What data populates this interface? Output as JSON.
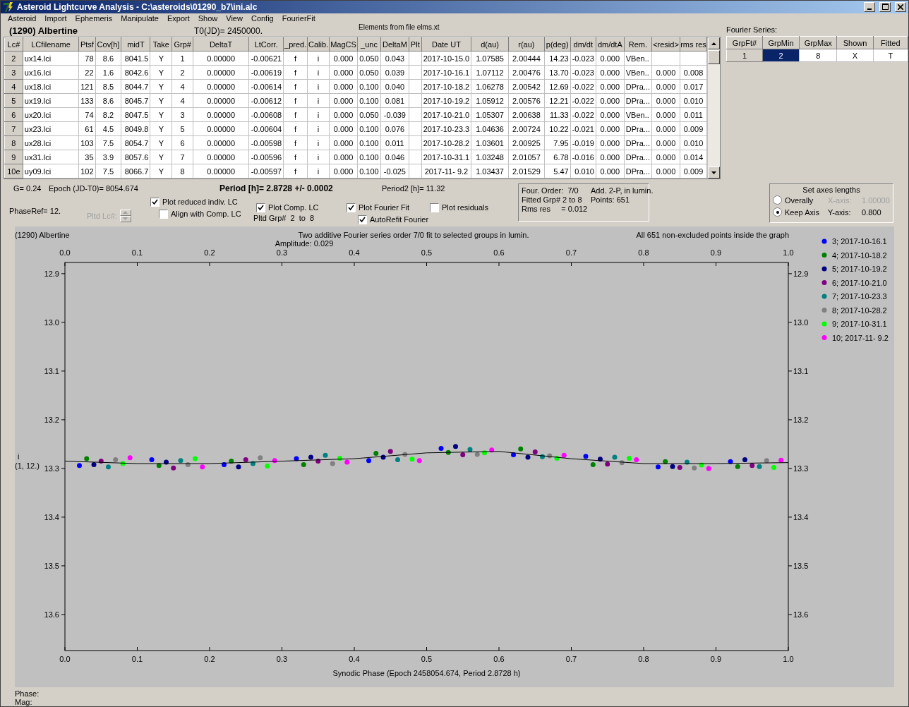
{
  "window": {
    "title": "Asteroid Lightcurve Analysis - C:\\asteroids\\01290_b7\\ini.alc"
  },
  "menu": [
    "Asteroid",
    "Import",
    "Ephemeris",
    "Manipulate",
    "Export",
    "Show",
    "View",
    "Config",
    "FourierFit"
  ],
  "header": {
    "asteroid": "(1290) Albertine",
    "t0": "T0(JD)= 2450000.",
    "elements": "Elements from file elms.xt"
  },
  "lc_table": {
    "columns": [
      "Lc#",
      "LCfilename",
      "Ptsf",
      "Cov[h]",
      "midT",
      "Take",
      "Grp#",
      "DeltaT",
      "LtCorr.",
      "_pred.",
      "Calib.",
      "MagCS",
      "_unc",
      "DeltaM",
      "Plt",
      "Date UT",
      "d(au)",
      "r(au)",
      "p(deg)",
      "dm/dt",
      "dm/dtA",
      "Rem.",
      "<resid>",
      "rms res"
    ],
    "rows": [
      [
        "2",
        "ux14.lci",
        "78",
        "8.6",
        "8041.5",
        "Y",
        "1",
        "0.00000",
        "-0.00621",
        "f",
        "i",
        "0.000",
        "0.050",
        "0.043",
        "",
        "2017-10-15.0",
        "1.07585",
        "2.00444",
        "14.23",
        "-0.023",
        "0.000",
        "VBen..",
        "",
        ""
      ],
      [
        "3",
        "ux16.lci",
        "22",
        "1.6",
        "8042.6",
        "Y",
        "2",
        "0.00000",
        "-0.00619",
        "f",
        "i",
        "0.000",
        "0.050",
        "0.039",
        "",
        "2017-10-16.1",
        "1.07112",
        "2.00476",
        "13.70",
        "-0.023",
        "0.000",
        "VBen..",
        "0.000",
        "0.008"
      ],
      [
        "4",
        "ux18.lci",
        "121",
        "8.5",
        "8044.7",
        "Y",
        "4",
        "0.00000",
        "-0.00614",
        "f",
        "i",
        "0.000",
        "0.100",
        "0.040",
        "",
        "2017-10-18.2",
        "1.06278",
        "2.00542",
        "12.69",
        "-0.022",
        "0.000",
        "DPra...",
        "0.000",
        "0.017"
      ],
      [
        "5",
        "ux19.lci",
        "133",
        "8.6",
        "8045.7",
        "Y",
        "4",
        "0.00000",
        "-0.00612",
        "f",
        "i",
        "0.000",
        "0.100",
        "0.081",
        "",
        "2017-10-19.2",
        "1.05912",
        "2.00576",
        "12.21",
        "-0.022",
        "0.000",
        "DPra...",
        "0.000",
        "0.010"
      ],
      [
        "6",
        "ux20.lci",
        "74",
        "8.2",
        "8047.5",
        "Y",
        "3",
        "0.00000",
        "-0.00608",
        "f",
        "i",
        "0.000",
        "0.050",
        "-0.039",
        "",
        "2017-10-21.0",
        "1.05307",
        "2.00638",
        "11.33",
        "-0.022",
        "0.000",
        "VBen..",
        "0.000",
        "0.011"
      ],
      [
        "7",
        "ux23.lci",
        "61",
        "4.5",
        "8049.8",
        "Y",
        "5",
        "0.00000",
        "-0.00604",
        "f",
        "i",
        "0.000",
        "0.100",
        "0.076",
        "",
        "2017-10-23.3",
        "1.04636",
        "2.00724",
        "10.22",
        "-0.021",
        "0.000",
        "DPra...",
        "0.000",
        "0.009"
      ],
      [
        "8",
        "ux28.lci",
        "103",
        "7.5",
        "8054.7",
        "Y",
        "6",
        "0.00000",
        "-0.00598",
        "f",
        "i",
        "0.000",
        "0.100",
        "0.011",
        "",
        "2017-10-28.2",
        "1.03601",
        "2.00925",
        "7.95",
        "-0.019",
        "0.000",
        "DPra...",
        "0.000",
        "0.010"
      ],
      [
        "9",
        "ux31.lci",
        "35",
        "3.9",
        "8057.6",
        "Y",
        "7",
        "0.00000",
        "-0.00596",
        "f",
        "i",
        "0.000",
        "0.100",
        "0.046",
        "",
        "2017-10-31.1",
        "1.03248",
        "2.01057",
        "6.78",
        "-0.016",
        "0.000",
        "DPra...",
        "0.000",
        "0.014"
      ],
      [
        "10e",
        "uy09.lci",
        "102",
        "7.5",
        "8066.7",
        "Y",
        "8",
        "0.00000",
        "-0.00597",
        "f",
        "i",
        "0.000",
        "0.100",
        "-0.025",
        "",
        "2017-11- 9.2",
        "1.03437",
        "2.01529",
        "5.47",
        "0.010",
        "0.000",
        "DPra...",
        "0.000",
        "0.009"
      ]
    ]
  },
  "fourier": {
    "label": "Fourier Series:",
    "columns": [
      "GrpFt#",
      "GrpMin",
      "GrpMax",
      "Shown",
      "Fitted"
    ],
    "row": [
      {
        "text": "1",
        "selected": false
      },
      {
        "text": "2",
        "selected": true
      },
      {
        "text": "8",
        "selected": false
      },
      {
        "text": "X",
        "selected": false
      },
      {
        "text": "T",
        "selected": false
      }
    ]
  },
  "params": {
    "g": "G= 0.24",
    "epoch": "Epoch (JD-T0)= 8054.674",
    "period": "Period [h]= 2.8728 +/- 0.0002",
    "period2": "Period2 [h]= 11.32",
    "phaseref": "PhaseRef= 12.",
    "pltd_lc": {
      "label": "Pltd Lc#:",
      "disabled": true
    },
    "pltd_grp": "Pltd Grp#  2  to  8"
  },
  "checkboxes": [
    {
      "label": "Plot reduced indiv. LC",
      "checked": true
    },
    {
      "label": "Align with Comp. LC",
      "checked": false
    },
    {
      "label": "Plot Comp. LC",
      "checked": true
    },
    {
      "label": "Plot Fourier Fit",
      "checked": true
    },
    {
      "label": "Plot residuals",
      "checked": false
    },
    {
      "label": "AutoRefit Fourier",
      "checked": true
    }
  ],
  "fit_info": [
    "Four. Order:  7/0",
    "Add. 2-P, in lumin.",
    "Fitted Grp# 2 to 8",
    "Points: 651",
    "Rms res     = 0.012"
  ],
  "axes": {
    "title": "Set axes lengths",
    "options": [
      {
        "label": "Overally",
        "selected": false
      },
      {
        "label": "Keep Axis",
        "selected": true
      }
    ],
    "x_label": "X-axis:",
    "x_value": "1.00000",
    "x_disabled": true,
    "y_label": "Y-axis:",
    "y_value": "0.800"
  },
  "plot": {
    "header_left": "(1290) Albertine",
    "header_right": "All 651 non-excluded points inside the graph",
    "chart_data": {
      "type": "scatter",
      "title": "Two additive Fourier series order 7/0 fit to selected groups in lumin.",
      "subtitle": "Amplitude: 0.029",
      "xlabel": "Synodic Phase (Epoch 2458054.674, Period 2.8728 h)",
      "annotations": [
        {
          "text": "i"
        },
        {
          "text": "(1, 12.)"
        }
      ],
      "legend": "right",
      "xlim": [
        0,
        1
      ],
      "ylim": [
        13.674,
        12.877
      ],
      "xticks": [
        {
          "value": 0,
          "label": "0.0"
        },
        {
          "value": 0.1,
          "label": "0.1"
        },
        {
          "value": 0.2,
          "label": "0.2"
        },
        {
          "value": 0.3,
          "label": "0.3"
        },
        {
          "value": 0.4,
          "label": "0.4"
        },
        {
          "value": 0.5,
          "label": "0.5"
        },
        {
          "value": 0.6,
          "label": "0.6"
        },
        {
          "value": 0.7,
          "label": "0.7"
        },
        {
          "value": 0.8,
          "label": "0.8"
        },
        {
          "value": 0.9,
          "label": "0.9"
        },
        {
          "value": 1,
          "label": "1.0"
        }
      ],
      "yticks": [
        {
          "value": 12.9,
          "label": "12.9"
        },
        {
          "value": 13.0,
          "label": "13.0"
        },
        {
          "value": 13.1,
          "label": "13.1"
        },
        {
          "value": 13.2,
          "label": "13.2"
        },
        {
          "value": 13.3,
          "label": "13.3"
        },
        {
          "value": 13.4,
          "label": "13.4"
        },
        {
          "value": 13.5,
          "label": "13.5"
        },
        {
          "value": 13.6,
          "label": "13.6"
        }
      ],
      "series": [
        {
          "name": "3; 2017-10-16.1",
          "color": "#0000ff",
          "x": [
            0.02,
            0.12,
            0.22,
            0.32,
            0.42,
            0.52,
            0.62,
            0.72,
            0.82,
            0.92
          ],
          "values": [
            13.294,
            13.282,
            13.292,
            13.28,
            13.284,
            13.259,
            13.272,
            13.275,
            13.297,
            13.286
          ]
        },
        {
          "name": "4; 2017-10-18.2",
          "color": "#008000",
          "x": [
            0.03,
            0.13,
            0.23,
            0.33,
            0.43,
            0.53,
            0.63,
            0.73,
            0.83,
            0.93
          ],
          "values": [
            13.28,
            13.294,
            13.285,
            13.292,
            13.269,
            13.267,
            13.26,
            13.292,
            13.286,
            13.296
          ]
        },
        {
          "name": "5; 2017-10-19.2",
          "color": "#000080",
          "x": [
            0.04,
            0.14,
            0.24,
            0.34,
            0.44,
            0.54,
            0.64,
            0.74,
            0.84,
            0.94
          ],
          "values": [
            13.292,
            13.287,
            13.297,
            13.277,
            13.277,
            13.255,
            13.277,
            13.281,
            13.296,
            13.282
          ]
        },
        {
          "name": "6; 2017-10-21.0",
          "color": "#800080",
          "x": [
            0.05,
            0.15,
            0.25,
            0.35,
            0.45,
            0.55,
            0.65,
            0.75,
            0.85,
            0.95
          ],
          "values": [
            13.285,
            13.299,
            13.282,
            13.285,
            13.265,
            13.272,
            13.266,
            13.291,
            13.298,
            13.294
          ]
        },
        {
          "name": "7; 2017-10-23.3",
          "color": "#008080",
          "x": [
            0.06,
            0.16,
            0.26,
            0.36,
            0.46,
            0.56,
            0.66,
            0.76,
            0.86,
            0.96
          ],
          "values": [
            13.297,
            13.284,
            13.29,
            13.273,
            13.282,
            13.261,
            13.276,
            13.277,
            13.287,
            13.296
          ]
        },
        {
          "name": "8; 2017-10-28.2",
          "color": "#808080",
          "x": [
            0.07,
            0.17,
            0.27,
            0.37,
            0.47,
            0.57,
            0.67,
            0.77,
            0.87,
            0.97
          ],
          "values": [
            13.282,
            13.292,
            13.278,
            13.29,
            13.271,
            13.271,
            13.274,
            13.288,
            13.299,
            13.284
          ]
        },
        {
          "name": "9; 2017-10-31.1",
          "color": "#00ff00",
          "x": [
            0.08,
            0.18,
            0.28,
            0.38,
            0.48,
            0.58,
            0.68,
            0.78,
            0.88,
            0.98
          ],
          "values": [
            13.29,
            13.28,
            13.295,
            13.279,
            13.281,
            13.268,
            13.279,
            13.279,
            13.293,
            13.298
          ]
        },
        {
          "name": "10; 2017-11- 9.2",
          "color": "#ff00ff",
          "x": [
            0.09,
            0.19,
            0.29,
            0.39,
            0.49,
            0.59,
            0.69,
            0.79,
            0.89,
            0.99
          ],
          "values": [
            13.278,
            13.297,
            13.284,
            13.287,
            13.284,
            13.262,
            13.273,
            13.282,
            13.3,
            13.283
          ]
        },
        {
          "type": "line",
          "color": "#000000",
          "x": [
            0,
            0.1,
            0.2,
            0.3,
            0.4,
            0.5,
            0.6,
            0.7,
            0.8,
            0.9,
            1
          ],
          "values": [
            13.285,
            13.29,
            13.29,
            13.285,
            13.28,
            13.268,
            13.265,
            13.28,
            13.29,
            13.29,
            13.288
          ]
        }
      ]
    }
  },
  "status": [
    "Phase:",
    "Mag:"
  ]
}
